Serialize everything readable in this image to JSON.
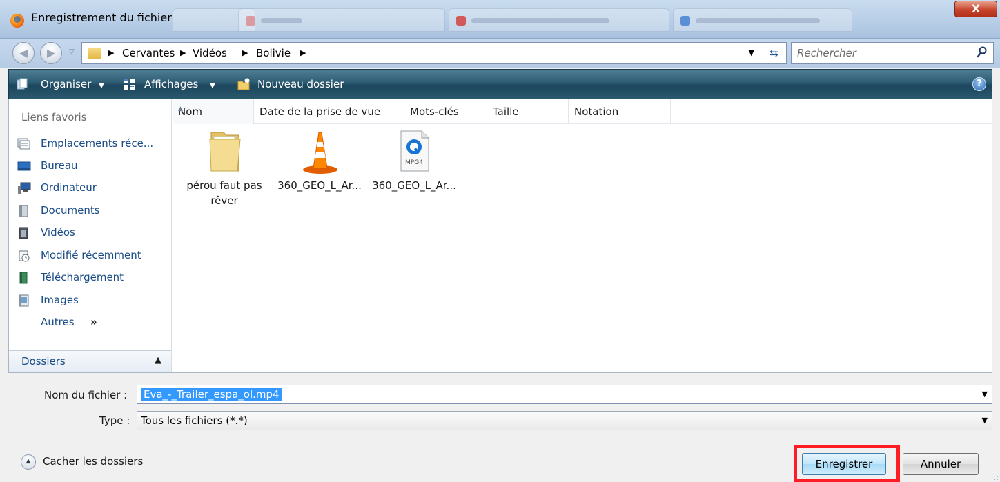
{
  "window": {
    "title": "Enregistrement du fichier",
    "close_label": "X"
  },
  "address": {
    "breadcrumbs": [
      "Cervantes",
      "Vidéos",
      "Bolivie"
    ]
  },
  "search": {
    "placeholder": "Rechercher"
  },
  "toolbar": {
    "organise_label": "Organiser",
    "views_label": "Affichages",
    "new_folder_label": "Nouveau dossier",
    "help_label": "?"
  },
  "navigation": {
    "header": "Liens favoris",
    "favorites": [
      {
        "label": "Emplacements réce...",
        "icon": "recent-places-icon"
      },
      {
        "label": "Bureau",
        "icon": "desktop-icon"
      },
      {
        "label": "Ordinateur",
        "icon": "computer-icon"
      },
      {
        "label": "Documents",
        "icon": "documents-icon"
      },
      {
        "label": "Vidéos",
        "icon": "videos-icon"
      },
      {
        "label": "Modifié récemment",
        "icon": "recently-changed-icon"
      },
      {
        "label": "Téléchargement",
        "icon": "downloads-icon"
      },
      {
        "label": "Images",
        "icon": "pictures-icon"
      },
      {
        "label": "Autres",
        "icon": "double-chevron-icon"
      }
    ],
    "more_chevron": "»",
    "folders_label": "Dossiers"
  },
  "columns": [
    "Nom",
    "Date de la prise de vue",
    "Mots-clés",
    "Taille",
    "Notation"
  ],
  "files": [
    {
      "name": "pérou faut pas rêver",
      "line1": "pérou faut pas",
      "line2": "rêver",
      "icon": "folder-icon"
    },
    {
      "name": "360_GEO_L_Ar...",
      "icon": "vlc-cone-icon"
    },
    {
      "name": "360_GEO_L_Ar...",
      "icon": "quicktime-mpg4-icon",
      "badge": "MPG4"
    }
  ],
  "form": {
    "filename_label": "Nom du fichier :",
    "filename_value": "Eva_-_Trailer_espa_ol.mp4",
    "type_label": "Type :",
    "type_value": "Tous les fichiers (*.*)"
  },
  "footer": {
    "hide_folders_label": "Cacher les dossiers",
    "save_label": "Enregistrer",
    "cancel_label": "Annuler"
  },
  "colors": {
    "toolbar": "#2c5b72",
    "link": "#1a4d86",
    "highlight": "#ff1d25",
    "selection": "#3399ff"
  }
}
